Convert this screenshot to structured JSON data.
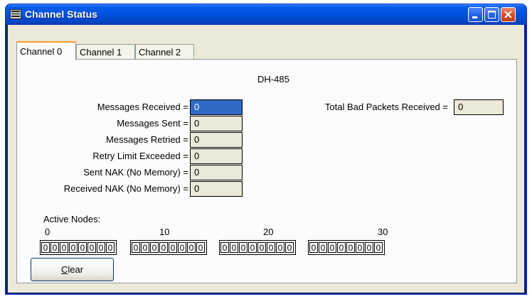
{
  "window": {
    "title": "Channel Status",
    "icon": "channel-status-app-icon",
    "controls": [
      "minimize-icon",
      "maximize-icon",
      "close-icon"
    ]
  },
  "tabs": [
    {
      "label": "Channel 0",
      "active": true
    },
    {
      "label": "Channel 1",
      "active": false
    },
    {
      "label": "Channel 2",
      "active": false
    }
  ],
  "protocol": "DH-485",
  "counters": {
    "messages_received": {
      "label": "Messages Received =",
      "value": "0"
    },
    "messages_sent": {
      "label": "Messages Sent =",
      "value": "0"
    },
    "messages_retried": {
      "label": "Messages Retried =",
      "value": "0"
    },
    "retry_limit_exceeded": {
      "label": "Retry Limit Exceeded =",
      "value": "0"
    },
    "sent_nak": {
      "label": "Sent NAK (No Memory) =",
      "value": "0"
    },
    "received_nak": {
      "label": "Received NAK (No Memory) =",
      "value": "0"
    },
    "total_bad_packets": {
      "label": "Total Bad Packets Received =",
      "value": "0"
    }
  },
  "active_nodes": {
    "label": "Active Nodes:",
    "markers": [
      "0",
      "10",
      "20",
      "30"
    ],
    "groups": [
      [
        "0",
        "0",
        "0",
        "0",
        "0",
        "0",
        "0",
        "0"
      ],
      [
        "0",
        "0",
        "0",
        "0",
        "0",
        "0",
        "0",
        "0"
      ],
      [
        "0",
        "0",
        "0",
        "0",
        "0",
        "0",
        "0",
        "0"
      ],
      [
        "0",
        "0",
        "0",
        "0",
        "0",
        "0",
        "0",
        "0"
      ]
    ]
  },
  "buttons": {
    "clear_mnemonic": "C",
    "clear_rest": "lear"
  },
  "colors": {
    "titlebar": "#0054e3",
    "dialog_background": "#ece9d8",
    "focus_highlight": "#316ac5",
    "close_button": "#dd4a22"
  }
}
